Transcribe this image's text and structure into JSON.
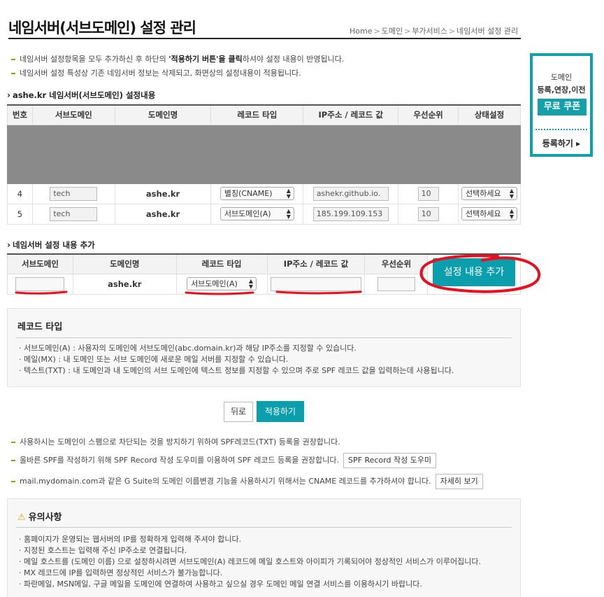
{
  "page": {
    "title": "네임서버(서브도메인) 설정 관리"
  },
  "breadcrumb": [
    "Home",
    "도메인",
    "부가서비스",
    "네임서버 설정 관리"
  ],
  "notes": [
    {
      "pre": "네임서버 설정항목을 모두 추가하신 후 하단의 ",
      "bold": "'적용하기 버튼'을 클릭",
      "post": "하셔야 설정 내용이 반영됩니다."
    },
    {
      "pre": "네임서버 설정 특성상 기존 네임서버 정보는 삭제되고, 화면상의 설정내용이 적용됩니다.",
      "bold": "",
      "post": ""
    }
  ],
  "current": {
    "heading": "ashe.kr 네임서버(서브도메인) 설정내용",
    "columns": [
      "번호",
      "서브도메인",
      "도메인명",
      "레코드 타입",
      "IP주소 / 레코드 값",
      "우선순위",
      "상태설정"
    ],
    "rows": [
      {
        "no": "4",
        "sub": "tech",
        "domain": "ashe.kr",
        "type": "별칭(CNAME)",
        "value": "ashekr.github.io.",
        "priority": "10",
        "status": "선택하세요"
      },
      {
        "no": "5",
        "sub": "tech",
        "domain": "ashe.kr",
        "type": "서브도메인(A)",
        "value": "185.199.109.153",
        "priority": "10",
        "status": "선택하세요"
      }
    ]
  },
  "add": {
    "heading": "네임서버 설정 내용 추가",
    "columns": [
      "서브도메인",
      "도메인명",
      "레코드 타입",
      "IP주소 / 레코드 값",
      "우선순위"
    ],
    "domain": "ashe.kr",
    "type": "서브도메인(A)",
    "button": "설정 내용 추가"
  },
  "record_types": {
    "title": "레코드 타입",
    "items": [
      "· 서브도메인(A) : 사용자의 도메인에 서브도메인(abc.domain.kr)과 해당 IP주소를 지정할 수 있습니다.",
      "· 메일(MX) : 내 도메인 또는 서브 도메인에 새로운 메일 서버를 지정할 수 있습니다.",
      "· 텍스트(TXT) : 내 도메인과 내 도메인의 서브 도메인에 텍스트 정보를 지정할 수 있으며 주로 SPF 레코드 값을 입력하는데 사용됩니다."
    ]
  },
  "actions": {
    "back": "뒤로",
    "apply": "적용하기"
  },
  "tips": [
    {
      "text": "사용하시는 도메인이 스팸으로 차단되는 것을 방지하기 위하여 SPF레코드(TXT) 등록을 권장합니다.",
      "button": ""
    },
    {
      "text": "올바른 SPF를 작성하기 위해 SPF Record 작성 도우미를 이용하여 SPF 레코드 등록을 권장합니다.",
      "button": "SPF Record 작성 도우미"
    },
    {
      "text": "mail.mydomain.com과 같은 G Suite의 도메인 이름변경 기능을 사용하시기 위해서는 CNAME 레코드를 추가하셔야 합니다.",
      "button": "자세히 보기"
    }
  ],
  "caution": {
    "title": "유의사항",
    "items": [
      "· 홈페이지가 운영되는 웹서버의 IP를 정확하게 입력해 주셔야 합니다.",
      "· 지정된 호스트는 입력해 주신 IP주소로 연결됩니다.",
      "· 메일 호스트를 (도메인 이름) 으로 설정하시려면 서브도메인(A) 레코드에 메일 호스트와 아이피가 기록되어야 정상적인 서비스가 이루어집니다.",
      "· MX 레코드에 IP를 입력하면 정상적인 서비스가 불가능합니다.",
      "· 파란메일, MSN메일, 구글 메일을 도메인에 연결하여 사용하고 싶으실 경우 도메인 메일 연결 서비스를 이용하시기 바랍니다."
    ]
  },
  "coupon": {
    "line1": "도메인",
    "line2": "등록,연장,이전",
    "badge": "무료 쿠폰",
    "cta": "등록하기",
    "color": "#13a0a8"
  },
  "colors": {
    "accent": "#0b9fae",
    "annotation": "#e8101e",
    "bullet": "#8ba600"
  }
}
